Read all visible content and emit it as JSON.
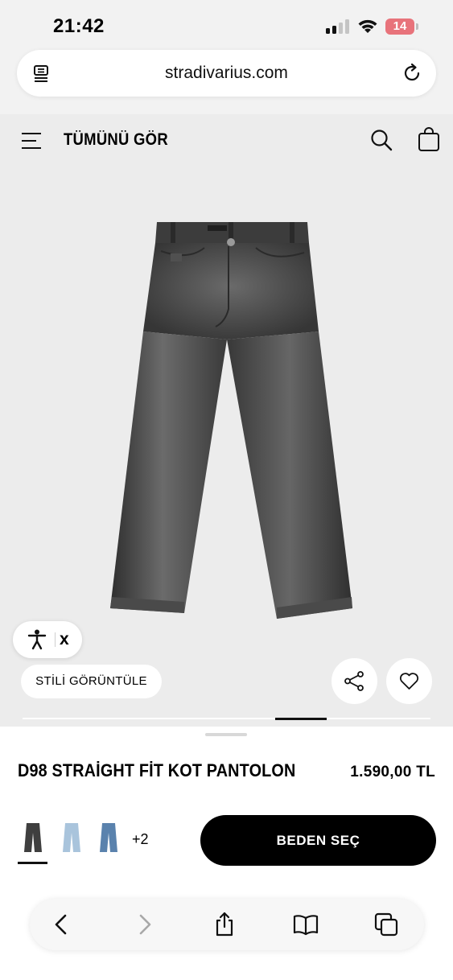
{
  "status_bar": {
    "time": "21:42",
    "battery": "14",
    "battery_color": "#e8737b"
  },
  "browser": {
    "url": "stradivarius.com"
  },
  "site_header": {
    "title": "TÜMÜNÜ GÖR",
    "icons": [
      "menu-icon",
      "search-icon",
      "shopping-bag-icon"
    ]
  },
  "product_gallery": {
    "image": "dark grey washed straight fit jeans",
    "accessibility_close": "x",
    "view_style_label": "STİLİ GÖRÜNTÜLE",
    "gallery_progress": 0.62
  },
  "product": {
    "name": "D98 STRAİGHT FİT KOT PANTOLON",
    "price": "1.590,00 TL",
    "color_swatches": [
      {
        "color": "#3f3f3f",
        "selected": true
      },
      {
        "color": "#a9c4dc",
        "selected": false
      },
      {
        "color": "#5a82ad",
        "selected": false
      }
    ],
    "more_colors": "+2",
    "select_size_label": "BEDEN SEÇ"
  },
  "toolbar": {
    "icons": [
      "back-icon",
      "forward-icon",
      "share-icon",
      "bookmarks-icon",
      "tabs-icon"
    ]
  },
  "colors": {
    "background": "#ececec",
    "primary_button": "#000000",
    "accent_text": "#111111"
  }
}
